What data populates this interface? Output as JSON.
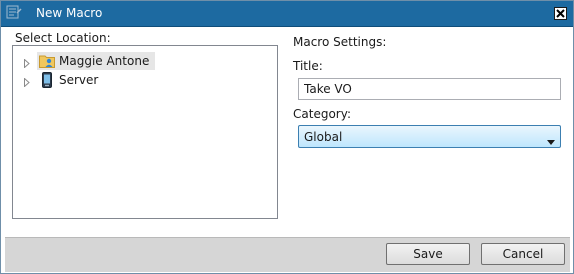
{
  "window": {
    "title": "New Macro",
    "icons": {
      "app": "macro-icon",
      "close": "close-icon"
    }
  },
  "location": {
    "label": "Select Location:",
    "tree": [
      {
        "label": "Maggie Antone",
        "icon": "user-folder-icon",
        "selected": true,
        "expanded": false
      },
      {
        "label": "Server",
        "icon": "server-device-icon",
        "selected": false,
        "expanded": false
      }
    ]
  },
  "settings": {
    "heading": "Macro Settings:",
    "title_label": "Title:",
    "title_value": "Take VO",
    "category_label": "Category:",
    "category_value": "Global"
  },
  "footer": {
    "save_label": "Save",
    "cancel_label": "Cancel"
  },
  "colors": {
    "titlebar": "#1d6aa1",
    "footer": "#d6d6d6",
    "select_accent": "#3c7fb1"
  }
}
